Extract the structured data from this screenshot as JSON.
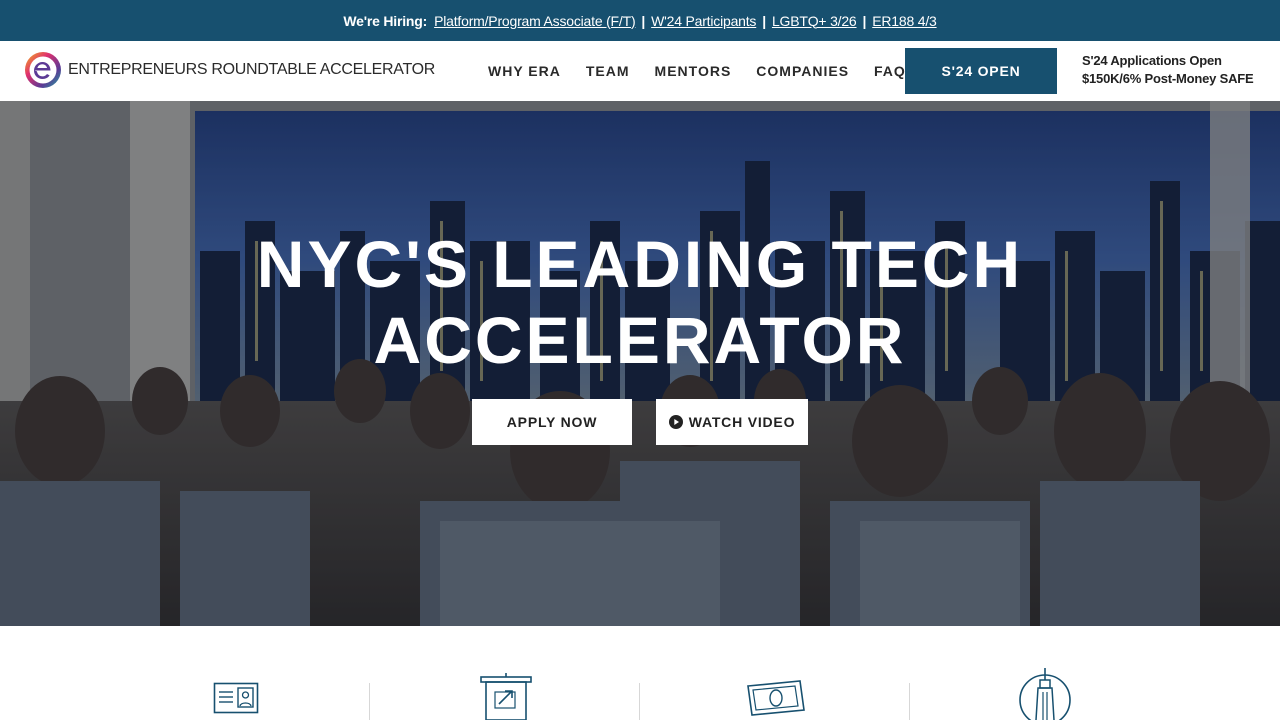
{
  "topbar": {
    "label": "We're Hiring:",
    "links": [
      "Platform/Program Associate (F/T)",
      "W'24 Participants",
      "LGBTQ+ 3/26",
      "ER188 4/3"
    ],
    "separator": "|"
  },
  "header": {
    "logo_text": "ENTREPRENEURS ROUNDTABLE ACCELERATOR",
    "logo_icon": "era-logo-icon",
    "nav": [
      "WHY ERA",
      "TEAM",
      "MENTORS",
      "COMPANIES",
      "FAQ"
    ],
    "cta_label": "S'24 OPEN",
    "apps_line1": "S'24 Applications Open",
    "apps_line2": "$150K/6% Post-Money SAFE"
  },
  "hero": {
    "title_line1": "NYC'S LEADING TECH",
    "title_line2": "ACCELERATOR",
    "apply_label": "APPLY NOW",
    "watch_label": "WATCH VIDEO",
    "watch_icon": "play-icon"
  },
  "features": {
    "icons": [
      "id-card-icon",
      "presentation-board-icon",
      "money-bill-icon",
      "empire-state-building-icon"
    ]
  },
  "colors": {
    "brand": "#17506f",
    "white": "#ffffff",
    "text_dark": "#222222"
  }
}
